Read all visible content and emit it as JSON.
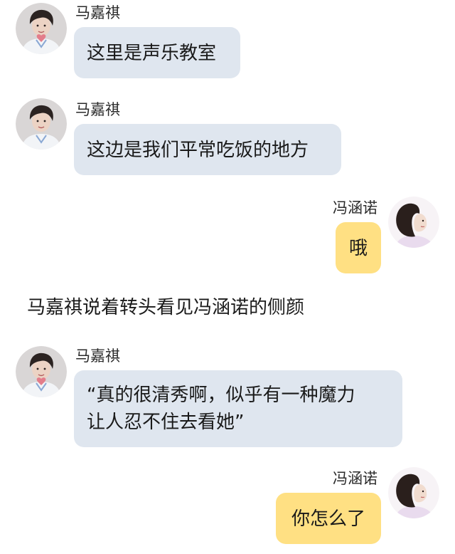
{
  "speakers": {
    "left_name": "马嘉祺",
    "right_name": "冯涵诺"
  },
  "messages": [
    {
      "side": "left",
      "name": "马嘉祺",
      "lines": [
        "这里是声乐教室"
      ]
    },
    {
      "side": "left",
      "name": "马嘉祺",
      "lines": [
        "这边是我们平常吃饭的地方"
      ]
    },
    {
      "side": "right",
      "name": "冯涵诺",
      "lines": [
        "哦"
      ]
    },
    {
      "side": "left",
      "name": "马嘉祺",
      "lines": [
        "“真的很清秀啊，似乎有一种魔力",
        "让人忍不住去看她”"
      ]
    },
    {
      "side": "right",
      "name": "冯涵诺",
      "lines": [
        "你怎么了"
      ]
    }
  ],
  "narration": "马嘉祺说着转头看见冯涵诺的侧颜",
  "colors": {
    "left_bubble": "#dfe6ef",
    "right_bubble": "#ffe083"
  }
}
